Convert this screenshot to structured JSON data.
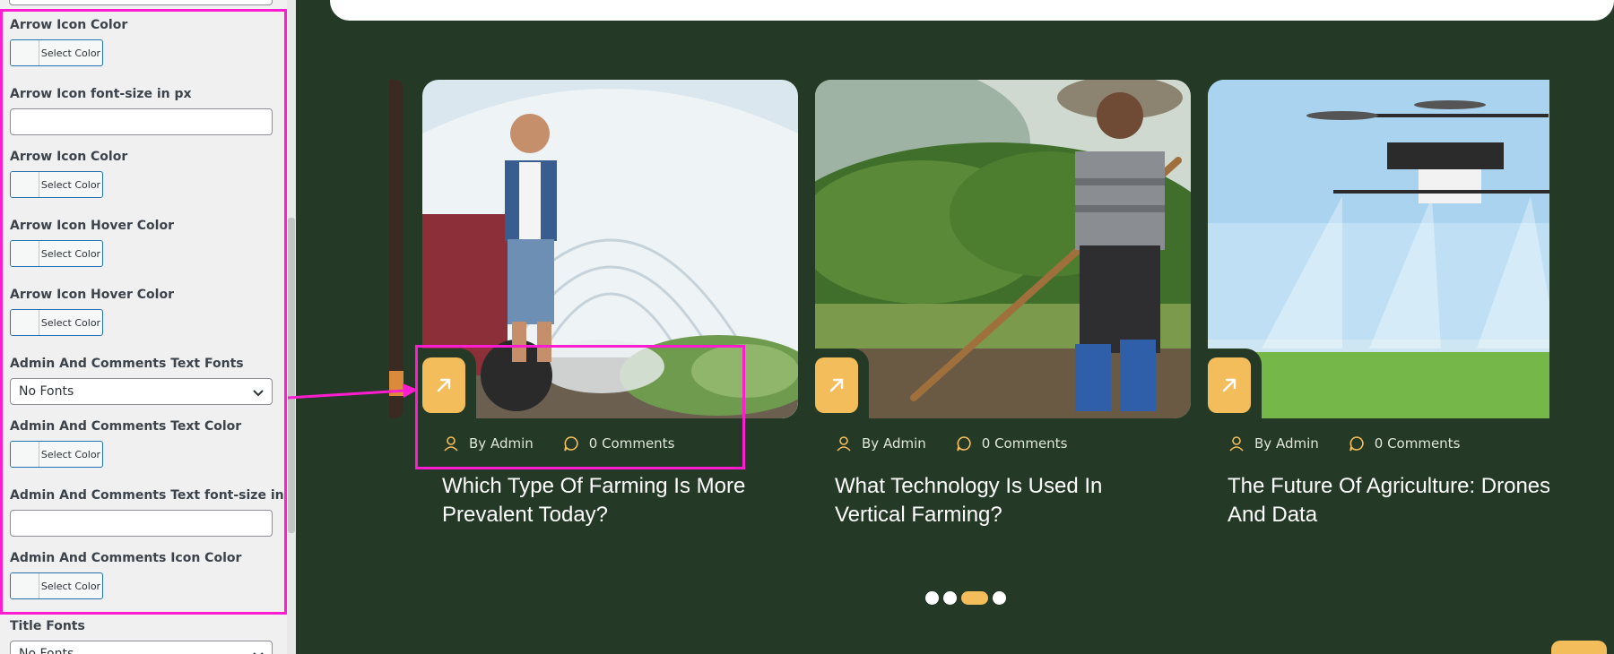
{
  "sidebar": {
    "settings": [
      {
        "label": "Arrow Icon Color",
        "type": "color",
        "button": "Select Color"
      },
      {
        "label": "Arrow Icon font-size in px",
        "type": "text",
        "value": ""
      },
      {
        "label": "Arrow Icon Color",
        "type": "color",
        "button": "Select Color"
      },
      {
        "label": "Arrow Icon Hover Color",
        "type": "color",
        "button": "Select Color"
      },
      {
        "label": "Arrow Icon Hover Color",
        "type": "color",
        "button": "Select Color"
      },
      {
        "label": "Admin And Comments Text Fonts",
        "type": "select",
        "value": "No Fonts"
      },
      {
        "label": "Admin And Comments Text Color",
        "type": "color",
        "button": "Select Color"
      },
      {
        "label": "Admin And Comments Text font-size in px",
        "type": "text",
        "value": ""
      },
      {
        "label": "Admin And Comments Icon Color",
        "type": "color",
        "button": "Select Color"
      },
      {
        "label": "Title Fonts",
        "type": "select",
        "value": "No Fonts"
      }
    ]
  },
  "preview": {
    "cards": [
      {
        "author_prefix": "By",
        "author": "Admin",
        "comments": "0 Comments",
        "title_line1": "Which Type Of Farming Is More",
        "title_line2": "Prevalent Today?",
        "image": "greenhouse-farmer-photo"
      },
      {
        "author_prefix": "By",
        "author": "Admin",
        "comments": "0 Comments",
        "title_line1": "What Technology Is Used In",
        "title_line2": "Vertical Farming?",
        "image": "farmer-with-hoe-photo"
      },
      {
        "author_prefix": "By",
        "author": "Admin",
        "comments": "0 Comments",
        "title_line1": "The Future Of Agriculture: Drones",
        "title_line2": "And Data",
        "image": "drone-spraying-field-photo"
      }
    ],
    "pagination": {
      "count": 4,
      "active_index": 2
    }
  },
  "colors": {
    "highlight": "#ff1cd1",
    "accent": "#f4bd5c",
    "preview_bg": "#243a26",
    "sidebar_bg": "#f0f0f1",
    "wp_blue": "#2271b1"
  },
  "icons": [
    "arrow-up-right-icon",
    "user-icon",
    "comment-icon",
    "chevron-down-icon"
  ]
}
